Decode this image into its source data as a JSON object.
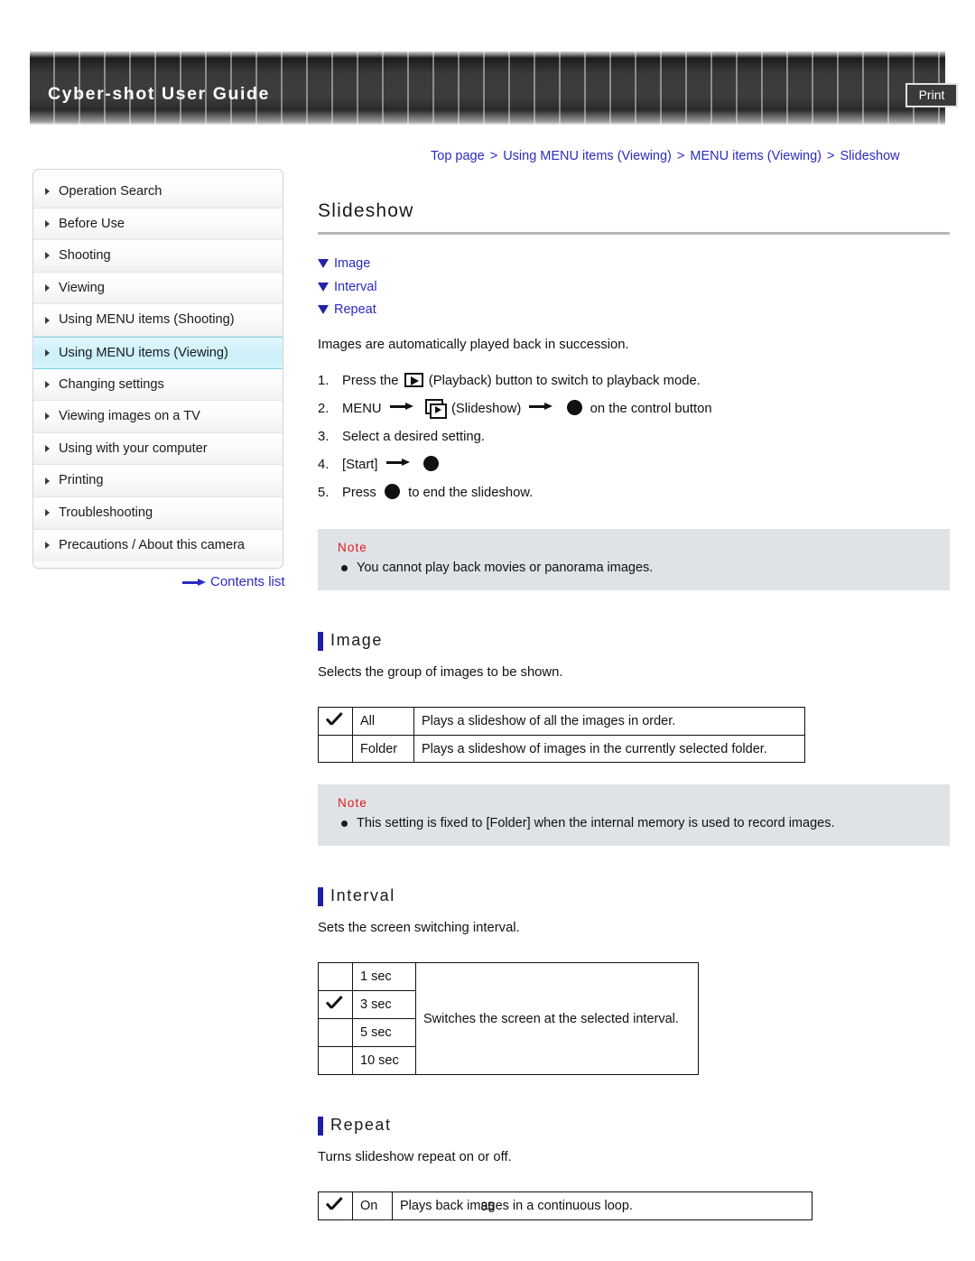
{
  "header": {
    "title": "Cyber-shot User Guide",
    "print_label": "Print"
  },
  "breadcrumb": {
    "items": [
      "Top page",
      "Using MENU items (Viewing)",
      "MENU items (Viewing)",
      "Slideshow"
    ],
    "separator": ">"
  },
  "sidebar": {
    "items": [
      {
        "label": "Operation Search",
        "selected": false
      },
      {
        "label": "Before Use",
        "selected": false
      },
      {
        "label": "Shooting",
        "selected": false
      },
      {
        "label": "Viewing",
        "selected": false
      },
      {
        "label": "Using MENU items (Shooting)",
        "selected": false
      },
      {
        "label": "Using MENU items (Viewing)",
        "selected": true
      },
      {
        "label": "Changing settings",
        "selected": false
      },
      {
        "label": "Viewing images on a TV",
        "selected": false
      },
      {
        "label": "Using with your computer",
        "selected": false
      },
      {
        "label": "Printing",
        "selected": false
      },
      {
        "label": "Troubleshooting",
        "selected": false
      },
      {
        "label": "Precautions / About this camera",
        "selected": false
      }
    ],
    "contents_link": "Contents list"
  },
  "main": {
    "title": "Slideshow",
    "anchors": [
      "Image",
      "Interval",
      "Repeat"
    ],
    "intro": "Images are automatically played back in succession.",
    "steps": [
      {
        "num": "1.",
        "before": "Press the",
        "icon": "playback-icon",
        "after": "(Playback) button to switch to playback mode."
      },
      {
        "num": "2.",
        "before": "MENU",
        "icon": "slideshow-icon",
        "mid": "(Slideshow)",
        "after": "on the control button"
      },
      {
        "num": "3.",
        "text": "Select a desired setting."
      },
      {
        "num": "4.",
        "text": "[Start]"
      },
      {
        "num": "5.",
        "before": "Press",
        "after": "to end the slideshow."
      }
    ],
    "note1": {
      "title": "Note",
      "items": [
        "You cannot play back movies or panorama images."
      ]
    },
    "image_section": {
      "heading": "Image",
      "description": "Selects the group of images to be shown.",
      "rows": [
        {
          "checked": true,
          "option": "All",
          "description": "Plays a slideshow of all the images in order."
        },
        {
          "checked": false,
          "option": "Folder",
          "description": "Plays a slideshow of images in the currently selected folder."
        }
      ]
    },
    "note2": {
      "title": "Note",
      "items": [
        "This setting is fixed to [Folder] when the internal memory is used to record images."
      ]
    },
    "interval_section": {
      "heading": "Interval",
      "description": "Sets the screen switching interval.",
      "rows": [
        {
          "checked": false,
          "option": "1 sec"
        },
        {
          "checked": true,
          "option": "3 sec"
        },
        {
          "checked": false,
          "option": "5 sec"
        },
        {
          "checked": false,
          "option": "10 sec"
        }
      ],
      "shared_description": "Switches the screen at the selected interval."
    },
    "repeat_section": {
      "heading": "Repeat",
      "description": "Turns slideshow repeat on or off.",
      "rows": [
        {
          "checked": true,
          "option": "On",
          "description": "Plays back images in a continuous loop."
        }
      ]
    }
  },
  "footer": {
    "page_number": "85"
  },
  "colors": {
    "link": "#2b2bc0",
    "note_title": "#e01b1b",
    "note_bg": "#dfe2e7",
    "section_bar": "#1f1fa8",
    "selected_item_bg": "#ccf0fa"
  }
}
